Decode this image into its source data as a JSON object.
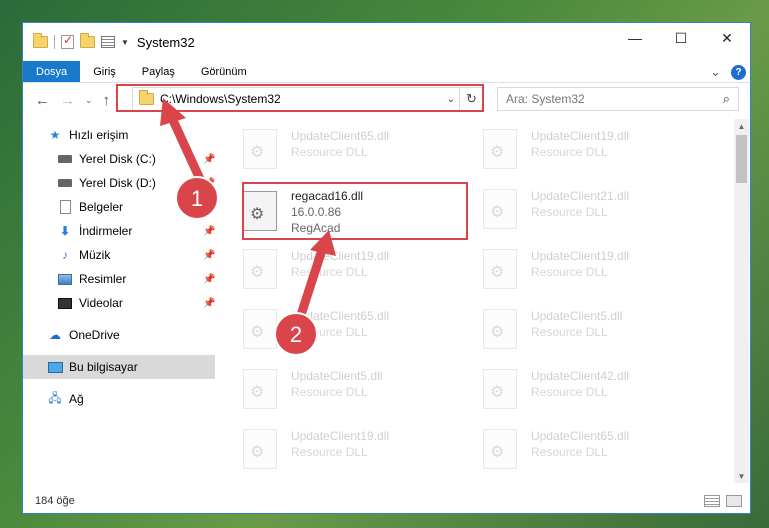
{
  "window": {
    "title": "System32",
    "controls": {
      "minimize": "—",
      "maximize": "☐",
      "close": "✕"
    }
  },
  "ribbon": {
    "tabs": [
      "Dosya",
      "Giriş",
      "Paylaş",
      "Görünüm"
    ],
    "expand_icon": "⌄",
    "help_icon": "?"
  },
  "address": {
    "path": "C:\\Windows\\System32",
    "search_placeholder": "Ara: System32",
    "icons": {
      "back": "←",
      "forward": "→",
      "recent": "⌄",
      "up": "↑",
      "dropdown": "⌄",
      "refresh": "↻",
      "search": "⌕"
    }
  },
  "nav_pane": {
    "quick_access": "Hızlı erişim",
    "items": [
      {
        "label": "Yerel Disk (C:)",
        "pinned": true
      },
      {
        "label": "Yerel Disk (D:)",
        "pinned": true
      },
      {
        "label": "Belgeler",
        "pinned": true
      },
      {
        "label": "İndirmeler",
        "pinned": true
      },
      {
        "label": "Müzik",
        "pinned": true
      },
      {
        "label": "Resimler",
        "pinned": true
      },
      {
        "label": "Videolar",
        "pinned": true
      }
    ],
    "onedrive": "OneDrive",
    "this_pc": "Bu bilgisayar",
    "network": "Ağ"
  },
  "files": [
    {
      "name": "UpdateClient65.dll",
      "desc": "Resource DLL"
    },
    {
      "name": "UpdateClient19.dll",
      "desc": "Resource DLL"
    },
    {
      "name": "regacad16.dll",
      "version": "16.0.0.86",
      "desc": "RegAcad"
    },
    {
      "name": "UpdateClient21.dll",
      "desc": "Resource DLL"
    },
    {
      "name": "UpdateClient19.dll",
      "desc": "Resource DLL"
    },
    {
      "name": "UpdateClient19.dll",
      "desc": "Resource DLL"
    },
    {
      "name": "UpdateClient65.dll",
      "desc": "Resource DLL"
    },
    {
      "name": "UpdateClient5.dll",
      "desc": "Resource DLL"
    },
    {
      "name": "UpdateClient5.dll",
      "desc": "Resource DLL"
    },
    {
      "name": "UpdateClient42.dll",
      "desc": "Resource DLL"
    },
    {
      "name": "UpdateClient19.dll",
      "desc": "Resource DLL"
    },
    {
      "name": "UpdateClient65.dll",
      "desc": "Resource DLL"
    }
  ],
  "status": {
    "count": "184 öğe"
  },
  "annotations": {
    "step1": "1",
    "step2": "2",
    "highlight_color": "#d9454a"
  }
}
